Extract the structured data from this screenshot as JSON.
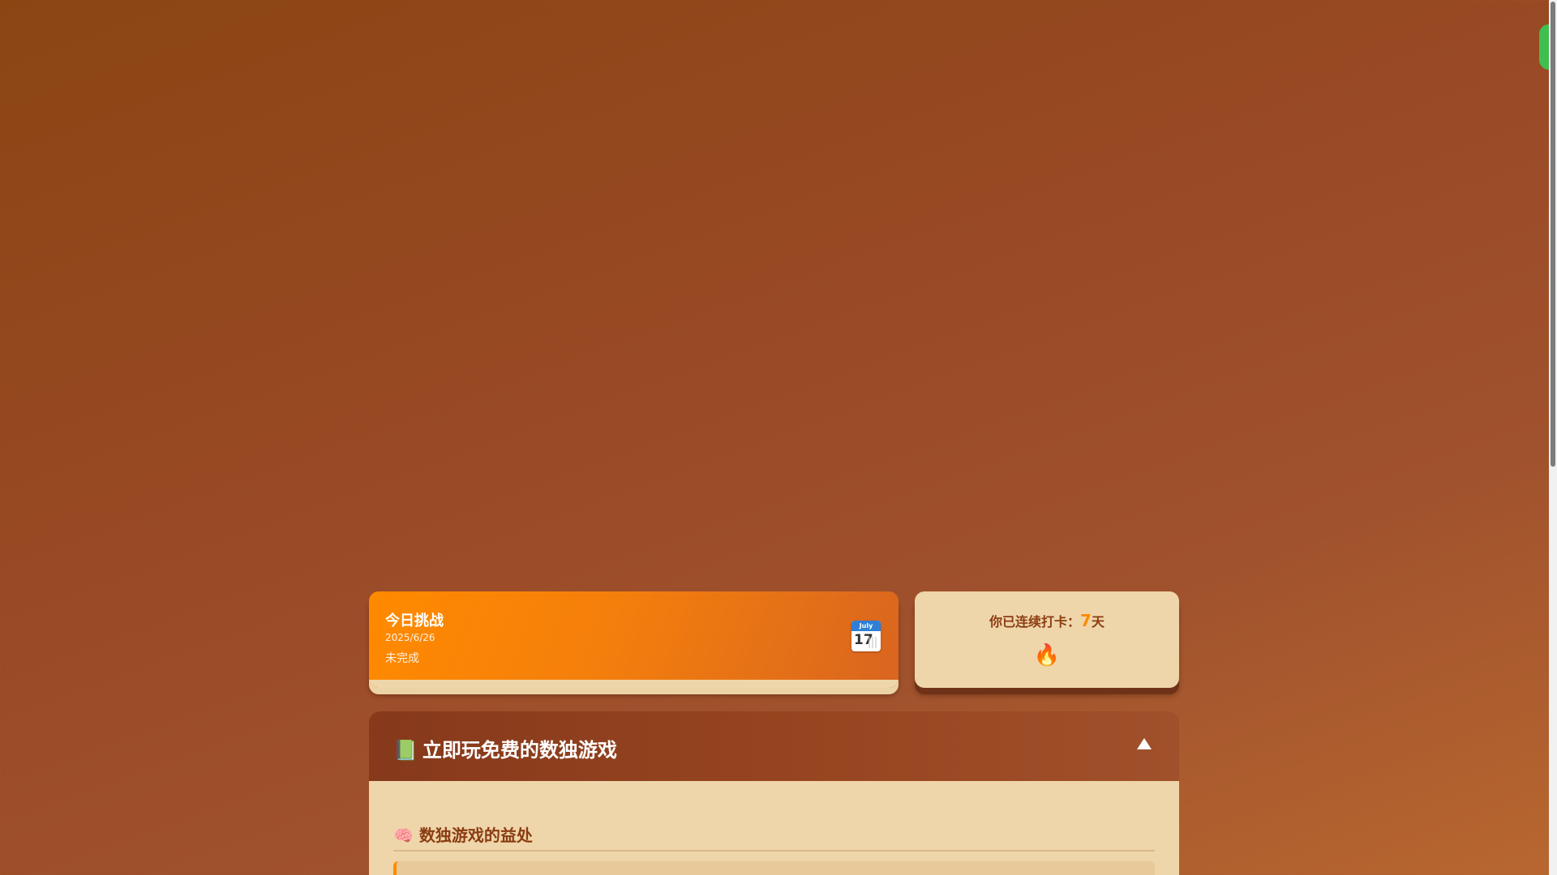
{
  "challenge": {
    "title": "今日挑战",
    "date": "2025/6/26",
    "status": "未完成",
    "calendar_month": "July",
    "calendar_day": "17"
  },
  "streak": {
    "prefix": "你已连续打卡：",
    "count": "7",
    "suffix": "天",
    "icon": "fire-icon"
  },
  "game_panel": {
    "title_icon": "📗",
    "title": "立即玩免费的数独游戏",
    "toggle_icon": "triangle-up-icon",
    "benefits_icon": "🧠",
    "benefits_heading": "数独游戏的益处"
  },
  "colors": {
    "accent": "#ff8a00",
    "card_bg": "#efd5aa",
    "brown_text": "#8b3c12",
    "header_brown": "#96441f"
  }
}
